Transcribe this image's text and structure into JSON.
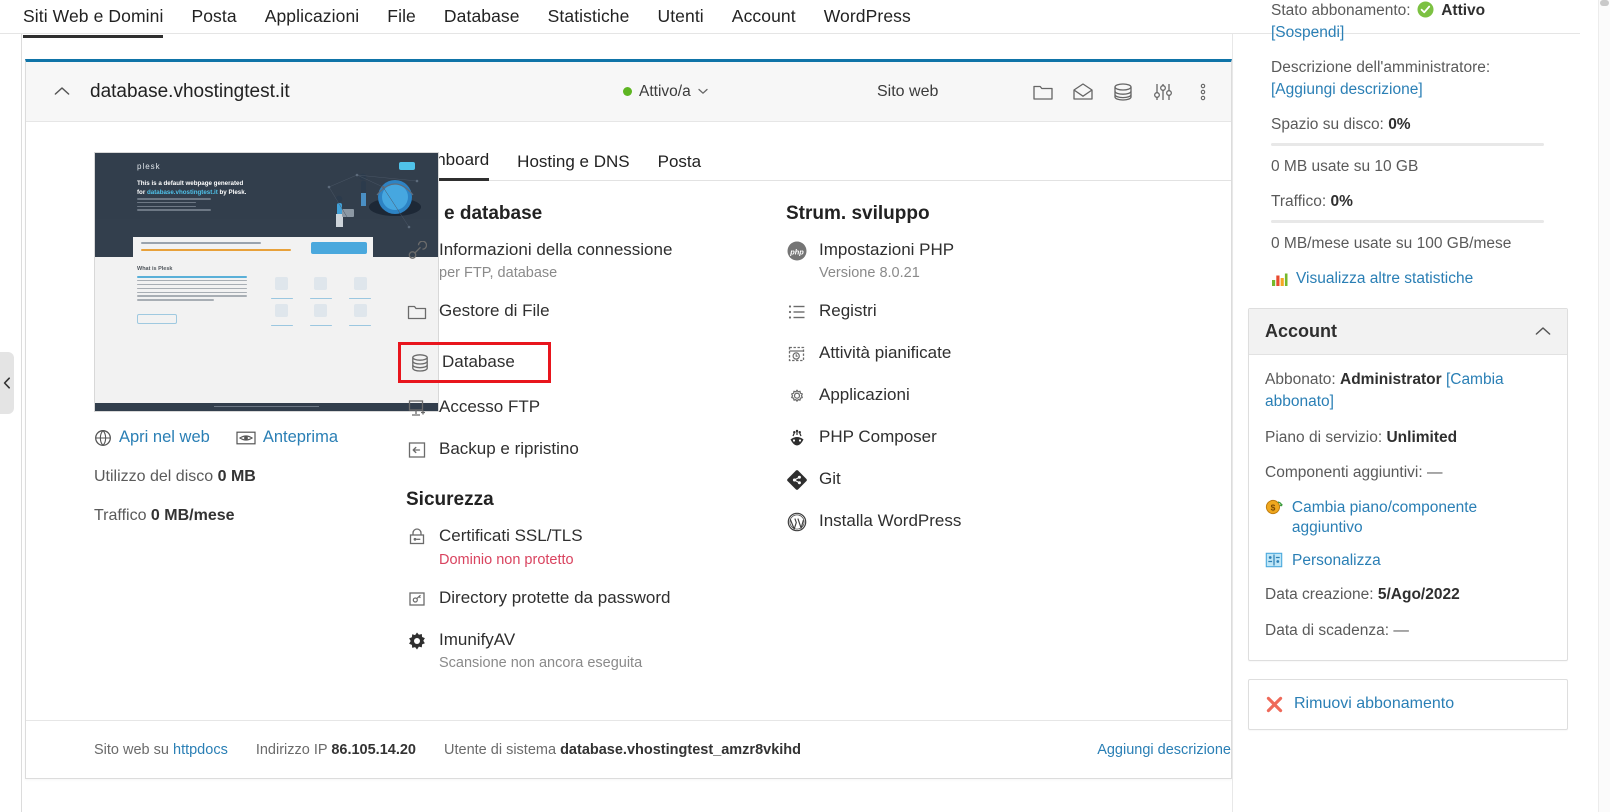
{
  "topnav": {
    "items": [
      {
        "label": "Siti Web e Domini",
        "active": true
      },
      {
        "label": "Posta",
        "active": false
      },
      {
        "label": "Applicazioni",
        "active": false
      },
      {
        "label": "File",
        "active": false
      },
      {
        "label": "Database",
        "active": false
      },
      {
        "label": "Statistiche",
        "active": false
      },
      {
        "label": "Utenti",
        "active": false
      },
      {
        "label": "Account",
        "active": false
      },
      {
        "label": "WordPress",
        "active": false
      }
    ]
  },
  "sidebar_handle": {
    "icon": "chevron-left-icon"
  },
  "card": {
    "header": {
      "collapse_icon": "chevron-up-icon",
      "domain": "database.vhostingtest.it",
      "status": "Attivo/a",
      "status_dropdown_icon": "chevron-down-icon",
      "status_color": "#5eb522",
      "hosting_type": "Sito web",
      "icons": [
        "folder-icon",
        "mail-icon",
        "database-icon",
        "sliders-icon",
        "kebab-menu-icon"
      ]
    },
    "preview": {
      "thumbnail_alt": "plesk-default-page-thumbnail",
      "plesk_logo": "plesk",
      "headline": "This is a default webpage generated for",
      "headline_domain": "database.vhostingtest.it",
      "headline_tail": " by Plesk.",
      "cta_button": "Log in to Plesk",
      "section_title": "What is Plesk",
      "open_web_link": "Apri nel web",
      "open_web_icon": "globe-icon",
      "preview_link": "Anteprima",
      "preview_icon": "eye-icon",
      "disk_usage_label": "Utilizzo del disco",
      "disk_usage_value": "0 MB",
      "traffic_label": "Traffico",
      "traffic_value": "0 MB/mese"
    },
    "tabs": [
      {
        "label": "Dashboard",
        "active": true
      },
      {
        "label": "Hosting e DNS",
        "active": false
      },
      {
        "label": "Posta",
        "active": false
      }
    ],
    "sections": {
      "files_db": {
        "title": "File e database",
        "items": [
          {
            "label": "Informazioni della connessione",
            "sub": "per FTP, database",
            "icon": "connection-icon",
            "highlight": false
          },
          {
            "label": "Gestore di File",
            "sub": "",
            "icon": "folder-icon",
            "highlight": false
          },
          {
            "label": "Database",
            "sub": "",
            "icon": "database-icon",
            "highlight": true
          },
          {
            "label": "Accesso FTP",
            "sub": "",
            "icon": "ftp-icon",
            "highlight": false
          },
          {
            "label": "Backup e ripristino",
            "sub": "",
            "icon": "backup-icon",
            "highlight": false
          }
        ]
      },
      "security": {
        "title": "Sicurezza",
        "items": [
          {
            "label": "Certificati SSL/TLS",
            "sub": "Dominio non protetto",
            "sub_danger": true,
            "icon": "lock-icon"
          },
          {
            "label": "Directory protette da password",
            "sub": "",
            "sub_danger": false,
            "icon": "protected-dir-icon"
          },
          {
            "label": "ImunifyAV",
            "sub": "Scansione non ancora eseguita",
            "sub_danger": false,
            "icon": "imunify-icon"
          }
        ]
      },
      "dev_tools": {
        "title": "Strum. sviluppo",
        "items": [
          {
            "label": "Impostazioni PHP",
            "sub": "Versione 8.0.21",
            "icon": "php-icon"
          },
          {
            "label": "Registri",
            "sub": "",
            "icon": "logs-icon"
          },
          {
            "label": "Attività pianificate",
            "sub": "",
            "icon": "scheduled-tasks-icon"
          },
          {
            "label": "Applicazioni",
            "sub": "",
            "icon": "gear-icon"
          },
          {
            "label": "PHP Composer",
            "sub": "",
            "icon": "composer-icon"
          },
          {
            "label": "Git",
            "sub": "",
            "icon": "git-icon"
          },
          {
            "label": "Installa WordPress",
            "sub": "",
            "icon": "wordpress-icon"
          }
        ]
      }
    },
    "footer": {
      "site_label": "Sito web su",
      "site_value": "httpdocs",
      "ip_label": "Indirizzo IP",
      "ip_value": "86.105.14.20",
      "sysuser_label": "Utente di sistema",
      "sysuser_value": "database.vhostingtest_amzr8vkihd",
      "add_description": "Aggiungi descrizione"
    }
  },
  "sidebar": {
    "subscription_status_label": "Stato abbonamento:",
    "subscription_status_value": "Attivo",
    "subscription_status_icon": "check-circle-icon",
    "suspend_link": "[Sospendi]",
    "admin_description_label": "Descrizione dell'amministratore:",
    "add_description_link": "[Aggiungi descrizione]",
    "disk_label": "Spazio su disco:",
    "disk_percent": "0%",
    "disk_detail": "0 MB usate su 10 GB",
    "traffic_label": "Traffico:",
    "traffic_percent": "0%",
    "traffic_detail": "0 MB/mese usate su 100 GB/mese",
    "more_stats_link": "Visualizza altre statistiche",
    "more_stats_icon": "bar-chart-icon",
    "account_panel": {
      "title": "Account",
      "collapse_icon": "chevron-up-icon",
      "subscriber_label": "Abbonato:",
      "subscriber_value": "Administrator",
      "change_subscriber_link": "[Cambia abbonato]",
      "plan_label": "Piano di servizio:",
      "plan_value": "Unlimited",
      "addons_label": "Componenti aggiuntivi:",
      "addons_value": "—",
      "change_plan_link": "Cambia piano/componente aggiuntivo",
      "change_plan_icon": "money-icon",
      "customize_link": "Personalizza",
      "customize_icon": "customize-icon",
      "created_label": "Data creazione:",
      "created_value": "5/Ago/2022",
      "expiry_label": "Data di scadenza:",
      "expiry_value": "—"
    },
    "remove_subscription": {
      "label": "Rimuovi abbonamento",
      "icon": "x-icon"
    }
  },
  "colors": {
    "accent_blue": "#2a7fb5",
    "card_top_border": "#0f74a8",
    "status_green": "#5eb522",
    "danger_red": "#d9435f",
    "highlight_red": "#e8151d"
  }
}
